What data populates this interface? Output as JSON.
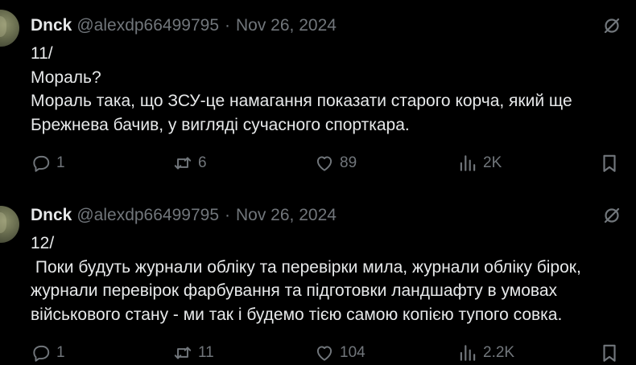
{
  "tweets": [
    {
      "author_name": "Dnck",
      "handle": "@alexdp66499795",
      "separator": "·",
      "date": "Nov 26, 2024",
      "text": "11/\nМораль?\nМораль така, що ЗСУ-це намагання показати старого корча, який ще\nБрежнева бачив, у вигляді сучасного спорткара.",
      "replies": "1",
      "retweets": "6",
      "likes": "89",
      "views": "2K"
    },
    {
      "author_name": "Dnck",
      "handle": "@alexdp66499795",
      "separator": "·",
      "date": "Nov 26, 2024",
      "text": "12/\n Поки будуть журнали обліку та перевірки мила, журнали обліку бірок,\nжурнали перевірок фарбування та підготовки ландшафту в умовах\nвійськового стану - ми так і будемо тією самою копією тупого совка.",
      "replies": "1",
      "retweets": "11",
      "likes": "104",
      "views": "2.2K"
    }
  ],
  "icons": {
    "reply": "reply-icon",
    "retweet": "retweet-icon",
    "like": "heart-icon",
    "views": "views-icon",
    "bookmark": "bookmark-icon",
    "grok": "grok-icon"
  },
  "colors": {
    "background": "#000000",
    "primary_text": "#e7e9ea",
    "secondary_text": "#71767b"
  }
}
